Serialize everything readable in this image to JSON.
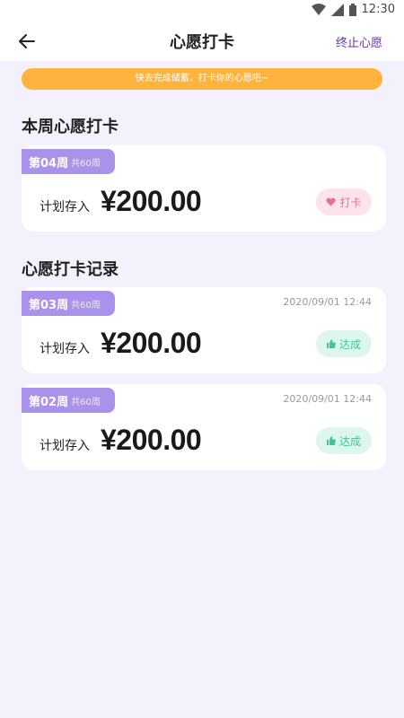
{
  "status": {
    "time": "12:30"
  },
  "appbar": {
    "title": "心愿打卡",
    "action": "终止心愿"
  },
  "banner": {
    "text": "快去完成储蓄，打卡你的心愿吧~"
  },
  "current": {
    "section_title": "本周心愿打卡",
    "week": "第04周",
    "total": "共60周",
    "plan_label": "计划存入",
    "amount": "¥200.00",
    "button": "打卡"
  },
  "records": {
    "section_title": "心愿打卡记录",
    "items": [
      {
        "week": "第03周",
        "total": "共60周",
        "date": "2020/09/01 12:44",
        "plan_label": "计划存入",
        "amount": "¥200.00",
        "status": "达成"
      },
      {
        "week": "第02周",
        "total": "共60周",
        "date": "2020/09/01 12:44",
        "plan_label": "计划存入",
        "amount": "¥200.00",
        "status": "达成"
      }
    ]
  },
  "colors": {
    "accent": "#5a37a8",
    "tag": "#a992ea",
    "banner": "#ffb33f",
    "pink": "#e5718f",
    "green": "#3ec797"
  }
}
